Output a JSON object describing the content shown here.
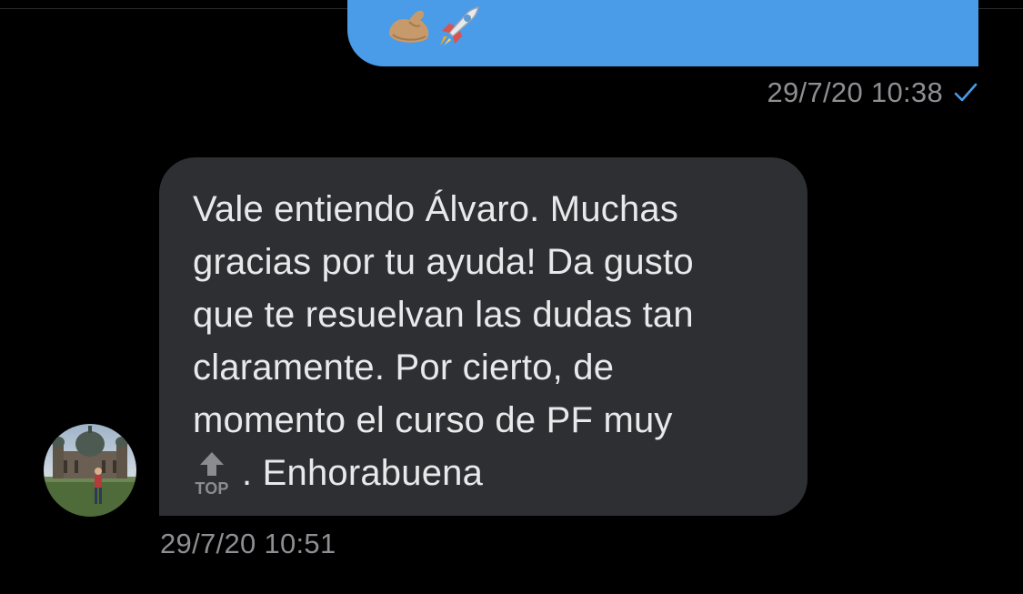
{
  "outgoing_message": {
    "emojis": [
      "flexed-biceps",
      "rocket"
    ],
    "timestamp": "29/7/20 10:38",
    "status_icon": "single-check-icon",
    "colors": {
      "bubble": "#4a9be8",
      "check": "#4a9be8"
    }
  },
  "incoming_message": {
    "lines": [
      "Vale entiendo Álvaro. Muchas",
      "gracias por tu ayuda! Da gusto",
      "que te resuelvan las dudas tan",
      "claramente. Por cierto, de",
      "momento el curso de PF muy"
    ],
    "last_line_emoji": "top-arrow-emoji",
    "last_line_emoji_label": "TOP",
    "last_line_text": ". Enhorabuena",
    "timestamp": "29/7/20 10:51",
    "colors": {
      "bubble": "#2d2f32",
      "text": "#e9e9eb"
    }
  },
  "sender": {
    "avatar_icon": "contact-avatar"
  }
}
